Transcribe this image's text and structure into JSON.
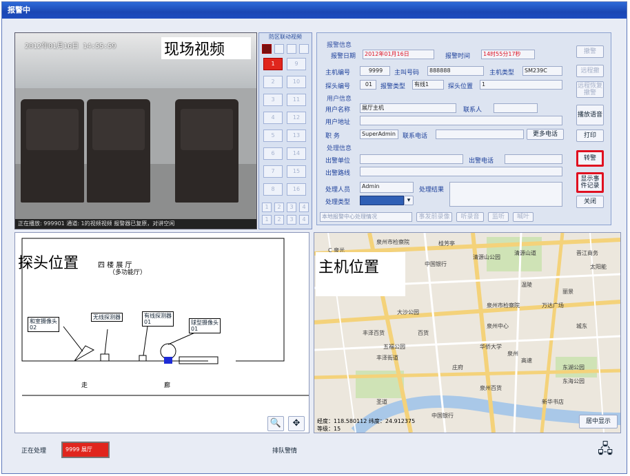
{
  "window": {
    "title": "报警中"
  },
  "video": {
    "overlay_label": "现场视频",
    "timestamp": "2012年01月16日  14:55:59",
    "status": "正在播放: 999901 通道: 1的视频视频          报警器已复原，对讲空闲"
  },
  "zones": {
    "header": "防区联动视频",
    "buttons": [
      "1",
      "9",
      "2",
      "10",
      "3",
      "11",
      "4",
      "12",
      "5",
      "13",
      "6",
      "14",
      "7",
      "15",
      "8",
      "16"
    ],
    "small": [
      "1",
      "2",
      "3",
      "4",
      "1",
      "2",
      "3",
      "4"
    ]
  },
  "info": {
    "alarm_section": "报警信息",
    "alarm_date_label": "报警日期",
    "alarm_date": "2012年01月16日",
    "alarm_time_label": "报警时间",
    "alarm_time": "14时55分17秒",
    "host_no_label": "主机编号",
    "host_no": "9999",
    "host_phone_label": "主叫号码",
    "host_phone": "888888",
    "host_type_label": "主机类型",
    "host_type": "SM239C",
    "probe_no_label": "探头编号",
    "probe_no": "01",
    "alarm_type_label": "报警类型",
    "alarm_type": "有线1",
    "probe_loc_label": "探头位置",
    "probe_loc": "1",
    "user_section": "用户信息",
    "user_name_label": "用户名称",
    "user_name": "展厅主机",
    "contact_label": "联系人",
    "contact": "",
    "user_addr_label": "用户地址",
    "duty_label": "职    务",
    "duty": "SuperAdmin",
    "phone_label": "联系电话",
    "more_phone": "更多电话",
    "handle_section": "处理信息",
    "dispatch_unit_label": "出警单位",
    "dispatch_phone_label": "出警电话",
    "dispatch_route_label": "出警路线",
    "handler_label": "处理人员",
    "handler": "Admin",
    "result_label": "处理结果",
    "handle_type_label": "处理类型",
    "center_route": "本地报警中心处理情况",
    "bottom_buttons": [
      "事发前录像",
      "听录音",
      "监听",
      "喊叶"
    ],
    "side_buttons": [
      "撤警",
      "远程撤",
      "远程恢复撤警",
      "播放语音",
      "打印",
      "转警",
      "显示事件记录",
      "关闭"
    ]
  },
  "plan": {
    "overlay_label": "探头位置",
    "title_line1": "四  楼  展  厅",
    "title_line2": "（多功能厅）",
    "sensors": [
      "和室摄像头",
      "无线探测器",
      "有线探测器",
      "球型摄像头"
    ],
    "sensor_codes": [
      "02",
      "",
      "01",
      "01"
    ],
    "corridor": "走",
    "corridor2": "廊",
    "tools": [
      "zoom-tool",
      "pan-tool"
    ]
  },
  "map": {
    "overlay_label": "主机位置",
    "labels": [
      "泉州市检察院",
      "桂芳亭",
      "中国银行",
      "清源山公园",
      "清源山道",
      "晋江商务",
      "太阳能",
      "泉州市检察院",
      "泉州中心",
      "百货",
      "五福公园",
      "丰泽街道",
      "东湖公园",
      "万达广场",
      "C 泉光",
      "温陵",
      "丽景",
      "城东",
      "泉州",
      "庄府",
      "丰泽百货",
      "泉州百货",
      "新华书店",
      "圣道",
      "中国银行",
      "高速",
      "华侨大学",
      "东海公园",
      "大沙公园"
    ],
    "coords": "经度：118.580112  纬度：24.912375",
    "level": "等级：15",
    "center_btn": "居中显示"
  },
  "statusbar": {
    "processing_label": "正在处理",
    "processing_value": "9999 展厅",
    "queue_label": "排队警情"
  }
}
